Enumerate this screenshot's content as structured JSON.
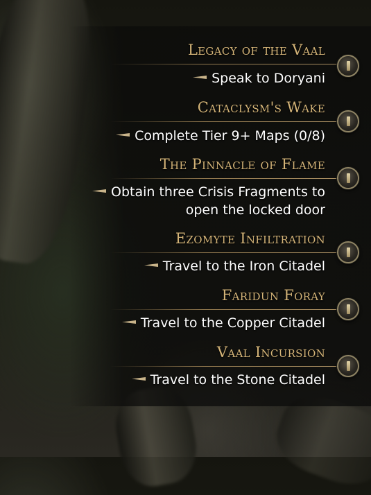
{
  "quests": [
    {
      "title": "Legacy of the Vaal",
      "objective": "Speak to Doryani"
    },
    {
      "title": "Cataclysm's Wake",
      "objective": "Complete Tier 9+ Maps (0/8)"
    },
    {
      "title": "The Pinnacle of Flame",
      "objective_line1": "Obtain three Crisis Fragments to",
      "objective_line2": "open the locked door"
    },
    {
      "title": "Ezomyte Infiltration",
      "objective": "Travel to the Iron Citadel"
    },
    {
      "title": "Faridun Foray",
      "objective": "Travel to the Copper Citadel"
    },
    {
      "title": "Vaal Incursion",
      "objective": "Travel to the Stone Citadel"
    }
  ],
  "colors": {
    "title": "#d4b478",
    "objective": "#ffffff",
    "rule": "#aa8c5a"
  },
  "icons": {
    "quest_marker": "quest-knob-icon",
    "bullet": "arrow-bullet-icon"
  }
}
